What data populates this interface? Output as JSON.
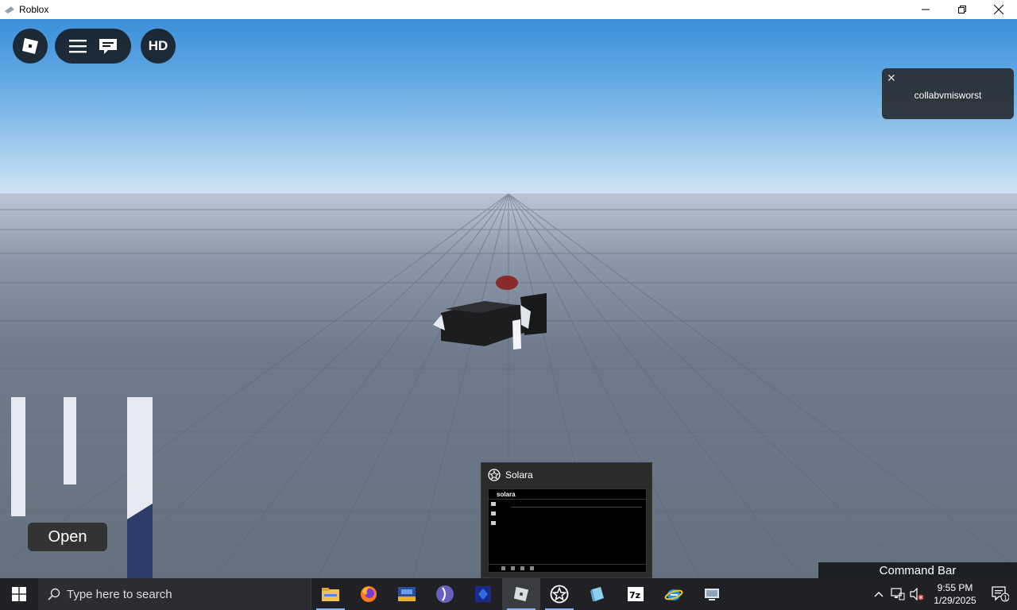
{
  "window": {
    "title": "Roblox",
    "controls": [
      "minimize",
      "restore",
      "close"
    ]
  },
  "game": {
    "top_buttons": {
      "hd_label": "HD"
    },
    "notification": {
      "text": "collabvmisworst"
    },
    "open_button_label": "Open",
    "command_bar_label": "Command Bar"
  },
  "taskbar": {
    "search_placeholder": "Type here to search",
    "apps": [
      {
        "icon": "file-explorer-icon",
        "running": true
      },
      {
        "icon": "firefox-icon",
        "running": false
      },
      {
        "icon": "app-2025-icon",
        "running": false
      },
      {
        "icon": "purple-app-icon",
        "running": false
      },
      {
        "icon": "blue-app-icon",
        "running": false
      },
      {
        "icon": "roblox-icon",
        "running": true,
        "active": true
      },
      {
        "icon": "solara-icon",
        "running": true
      },
      {
        "icon": "cube-app-icon",
        "running": false
      },
      {
        "icon": "7zip-icon",
        "running": false
      },
      {
        "icon": "internet-explorer-icon",
        "running": false
      },
      {
        "icon": "network-app-icon",
        "running": false
      }
    ],
    "thumbnail": {
      "title": "Solara",
      "preview_title": "solara"
    },
    "clock": {
      "time": "9:55 PM",
      "date": "1/29/2025"
    },
    "notification_count": "1"
  }
}
